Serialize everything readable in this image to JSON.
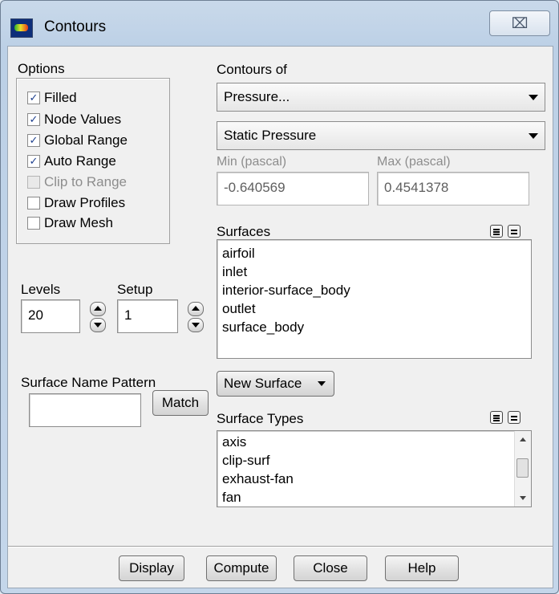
{
  "window": {
    "title": "Contours",
    "close_glyph": "⌧"
  },
  "options": {
    "label": "Options",
    "items": [
      {
        "label": "Filled",
        "checked": true,
        "enabled": true
      },
      {
        "label": "Node Values",
        "checked": true,
        "enabled": true
      },
      {
        "label": "Global Range",
        "checked": true,
        "enabled": true
      },
      {
        "label": "Auto Range",
        "checked": true,
        "enabled": true
      },
      {
        "label": "Clip to Range",
        "checked": false,
        "enabled": false
      },
      {
        "label": "Draw Profiles",
        "checked": false,
        "enabled": true
      },
      {
        "label": "Draw Mesh",
        "checked": false,
        "enabled": true
      }
    ]
  },
  "contours_of": {
    "label": "Contours of",
    "variable": "Pressure...",
    "subvariable": "Static Pressure"
  },
  "range": {
    "min_label": "Min (pascal)",
    "max_label": "Max (pascal)",
    "min_value": "-0.640569",
    "max_value": "0.4541378"
  },
  "levels": {
    "label": "Levels",
    "value": "20"
  },
  "setup": {
    "label": "Setup",
    "value": "1"
  },
  "surfaces": {
    "label": "Surfaces",
    "items": [
      "airfoil",
      "inlet",
      "interior-surface_body",
      "outlet",
      "surface_body"
    ]
  },
  "surface_name_pattern": {
    "label": "Surface Name Pattern",
    "value": "",
    "match_label": "Match"
  },
  "new_surface": {
    "label": "New Surface"
  },
  "surface_types": {
    "label": "Surface Types",
    "items": [
      "axis",
      "clip-surf",
      "exhaust-fan",
      "fan"
    ]
  },
  "buttons": {
    "display": "Display",
    "compute": "Compute",
    "close": "Close",
    "help": "Help"
  },
  "colors": {
    "accent": "#1d3f8e",
    "window_frame": "#bcd0e6",
    "client_bg": "#f0f0f0"
  }
}
